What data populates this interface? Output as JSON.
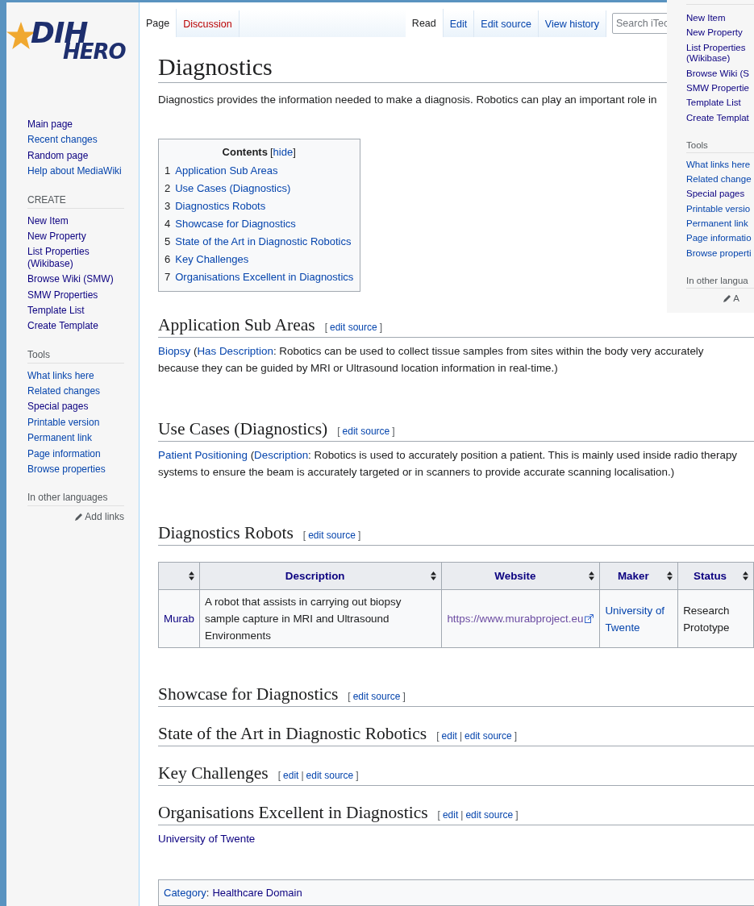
{
  "logo": {
    "top": "DIH",
    "bottom": "HERO"
  },
  "sidebar": {
    "navigation": [
      {
        "label": "Main page",
        "visited": true
      },
      {
        "label": "Recent changes",
        "visited": false
      },
      {
        "label": "Random page",
        "visited": true
      },
      {
        "label": "Help about MediaWiki",
        "visited": false
      }
    ],
    "sections": [
      {
        "heading": "CREATE",
        "items": [
          {
            "label": "New Item",
            "visited": true
          },
          {
            "label": "New Property",
            "visited": true
          },
          {
            "label": "List Properties (Wikibase)",
            "visited": true
          },
          {
            "label": "Browse Wiki (SMW)",
            "visited": true
          },
          {
            "label": "SMW Properties",
            "visited": true
          },
          {
            "label": "Template List",
            "visited": true
          },
          {
            "label": "Create Template",
            "visited": true
          }
        ]
      },
      {
        "heading": "Tools",
        "items": [
          {
            "label": "What links here",
            "visited": false
          },
          {
            "label": "Related changes",
            "visited": false
          },
          {
            "label": "Special pages",
            "visited": true
          },
          {
            "label": "Printable version",
            "visited": false
          },
          {
            "label": "Permanent link",
            "visited": false
          },
          {
            "label": "Page information",
            "visited": false
          },
          {
            "label": "Browse properties",
            "visited": false
          }
        ]
      },
      {
        "heading": "In other languages",
        "action": "Add links"
      }
    ]
  },
  "tabs_left": [
    {
      "label": "Page",
      "selected": true,
      "missing": false
    },
    {
      "label": "Discussion",
      "selected": false,
      "missing": true
    }
  ],
  "tabs_right": [
    {
      "label": "Read",
      "selected": true
    },
    {
      "label": "Edit",
      "selected": false
    },
    {
      "label": "Edit source",
      "selected": false
    },
    {
      "label": "View history",
      "selected": false
    }
  ],
  "search": {
    "placeholder": "Search iTec"
  },
  "overlay_panel": {
    "sections": [
      {
        "items": [
          {
            "label": "New Item",
            "visited": true
          },
          {
            "label": "New Property",
            "visited": true
          },
          {
            "label": "List Properties (Wikibase)",
            "visited": true
          },
          {
            "label": "Browse Wiki (S",
            "visited": true
          },
          {
            "label": "SMW Propertie",
            "visited": true
          },
          {
            "label": "Template List",
            "visited": true
          },
          {
            "label": "Create Templat",
            "visited": true
          }
        ]
      },
      {
        "heading": "Tools",
        "items": [
          {
            "label": "What links here",
            "visited": false
          },
          {
            "label": "Related change",
            "visited": false
          },
          {
            "label": "Special pages",
            "visited": true
          },
          {
            "label": "Printable versio",
            "visited": false
          },
          {
            "label": "Permanent link",
            "visited": false
          },
          {
            "label": "Page informatio",
            "visited": false
          },
          {
            "label": "Browse properti",
            "visited": false
          }
        ]
      },
      {
        "heading": "In other langua",
        "action": "A"
      }
    ]
  },
  "title": "Diagnostics",
  "intro": "Diagnostics provides the information needed to make a diagnosis. Robotics can play an important role in",
  "toc": {
    "title": "Contents",
    "toggle": [
      {
        "kind": "bracket",
        "text": "["
      },
      {
        "kind": "link",
        "text": "hide"
      },
      {
        "kind": "bracket",
        "text": "]"
      }
    ],
    "items": [
      {
        "number": "1",
        "label": "Application Sub Areas"
      },
      {
        "number": "2",
        "label": "Use Cases (Diagnostics)"
      },
      {
        "number": "3",
        "label": "Diagnostics Robots"
      },
      {
        "number": "4",
        "label": "Showcase for Diagnostics"
      },
      {
        "number": "5",
        "label": "State of the Art in Diagnostic Robotics"
      },
      {
        "number": "6",
        "label": "Key Challenges"
      },
      {
        "number": "7",
        "label": "Organisations Excellent in Diagnostics"
      }
    ]
  },
  "sections": [
    {
      "heading": "Application Sub Areas",
      "edit": [
        {
          "kind": "bracket",
          "text": "["
        },
        {
          "kind": "link",
          "text": "edit source"
        },
        {
          "kind": "bracket",
          "text": "]"
        }
      ],
      "content": [
        {
          "kind": "paragraph",
          "parts": [
            {
              "kind": "link",
              "text": "Biopsy"
            },
            {
              "kind": "text",
              "text": " ("
            },
            {
              "kind": "link",
              "text": "Has Description"
            },
            {
              "kind": "text",
              "text": ": Robotics can be used to collect tissue samples from sites within the body very accurately"
            },
            {
              "kind": "break"
            },
            {
              "kind": "text",
              "text": "because they can be guided by MRI or Ultrasound location information in real-time.)"
            }
          ]
        }
      ]
    },
    {
      "heading": "Use Cases (Diagnostics)",
      "edit": [
        {
          "kind": "bracket",
          "text": "["
        },
        {
          "kind": "link",
          "text": "edit source"
        },
        {
          "kind": "bracket",
          "text": "]"
        }
      ],
      "content": [
        {
          "kind": "paragraph",
          "parts": [
            {
              "kind": "link",
              "text": "Patient Positioning"
            },
            {
              "kind": "text",
              "text": " ("
            },
            {
              "kind": "link",
              "text": "Description"
            },
            {
              "kind": "text",
              "text": ": Robotics is used to accurately position a patient. This is mainly used inside radio therapy systems to ensure the beam is accurately targeted or in scanners to provide accurate scanning localisation.)"
            }
          ]
        }
      ]
    },
    {
      "heading": "Diagnostics Robots",
      "edit": [
        {
          "kind": "bracket",
          "text": "["
        },
        {
          "kind": "link",
          "text": "edit source"
        },
        {
          "kind": "bracket",
          "text": "]"
        }
      ],
      "content": [
        {
          "kind": "table",
          "columns": [
            {
              "sortable": true
            },
            {
              "label": "Description",
              "sortable": true
            },
            {
              "label": "Website",
              "sortable": true
            },
            {
              "label": "Maker",
              "sortable": true
            },
            {
              "label": "Status",
              "sortable": true
            }
          ],
          "rows": [
            [
              {
                "kind": "link",
                "text": "Murab",
                "visited": true
              },
              {
                "kind": "text",
                "text": "A robot that assists in carrying out biopsy sample capture in MRI and Ultrasound Environments"
              },
              {
                "kind": "external",
                "text": "https://www.murabproject.eu",
                "visited": true
              },
              {
                "kind": "link",
                "text": "University of Twente",
                "visited": false
              },
              {
                "kind": "text",
                "text": "Research Prototype"
              }
            ]
          ]
        }
      ]
    },
    {
      "heading": "Showcase for Diagnostics",
      "edit": [
        {
          "kind": "bracket",
          "text": "["
        },
        {
          "kind": "link",
          "text": "edit source"
        },
        {
          "kind": "bracket",
          "text": "]"
        }
      ]
    },
    {
      "heading": "State of the Art in Diagnostic Robotics",
      "edit": [
        {
          "kind": "bracket",
          "text": "["
        },
        {
          "kind": "link",
          "text": "edit"
        },
        {
          "kind": "separator",
          "text": "|"
        },
        {
          "kind": "link",
          "text": "edit source"
        },
        {
          "kind": "bracket",
          "text": "]"
        }
      ]
    },
    {
      "heading": "Key Challenges",
      "edit": [
        {
          "kind": "bracket",
          "text": "["
        },
        {
          "kind": "link",
          "text": "edit"
        },
        {
          "kind": "separator",
          "text": "|"
        },
        {
          "kind": "link",
          "text": "edit source"
        },
        {
          "kind": "bracket",
          "text": "]"
        }
      ]
    },
    {
      "heading": "Organisations Excellent in Diagnostics",
      "edit": [
        {
          "kind": "bracket",
          "text": "["
        },
        {
          "kind": "link",
          "text": "edit"
        },
        {
          "kind": "separator",
          "text": "|"
        },
        {
          "kind": "link",
          "text": "edit source"
        },
        {
          "kind": "bracket",
          "text": "]"
        }
      ],
      "content": [
        {
          "kind": "paragraph",
          "parts": [
            {
              "kind": "link",
              "text": "University of Twente",
              "visited": true
            }
          ]
        }
      ]
    }
  ],
  "category": {
    "label": "Category",
    "separator": ":",
    "links": [
      {
        "text": "Healthcare Domain",
        "visited": true
      }
    ]
  }
}
